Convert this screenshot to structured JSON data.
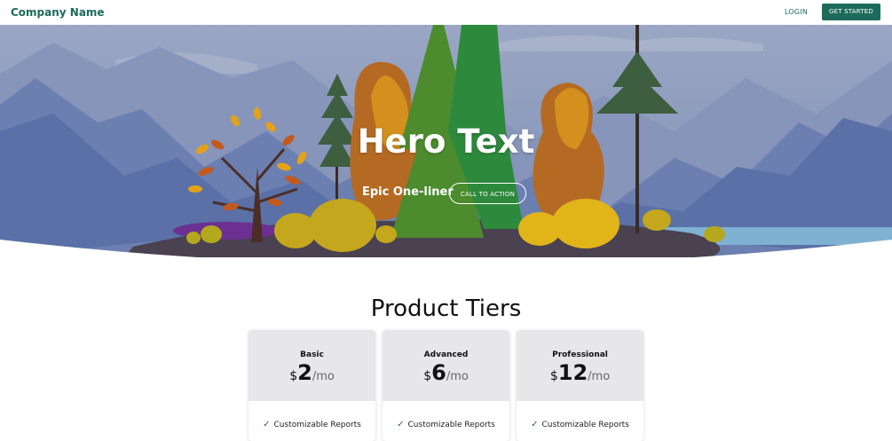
{
  "nav": {
    "brand": "Company Name",
    "login": "LOGIN",
    "get_started": "GET STARTED"
  },
  "hero": {
    "title": "Hero Text",
    "subtitle": "Epic One-liner",
    "cta": "CALL TO ACTION"
  },
  "pricing": {
    "title": "Product Tiers",
    "currency": "$",
    "period": "/mo",
    "tiers": [
      {
        "name": "Basic",
        "price": "2",
        "feature": "Customizable Reports"
      },
      {
        "name": "Advanced",
        "price": "6",
        "feature": "Customizable Reports"
      },
      {
        "name": "Professional",
        "price": "12",
        "feature": "Customizable Reports"
      }
    ]
  },
  "colors": {
    "brand": "#1c6b5a",
    "card_header": "#e7e7ea",
    "sky": "#8f9dbd"
  },
  "icons": {
    "check": "check-icon"
  }
}
